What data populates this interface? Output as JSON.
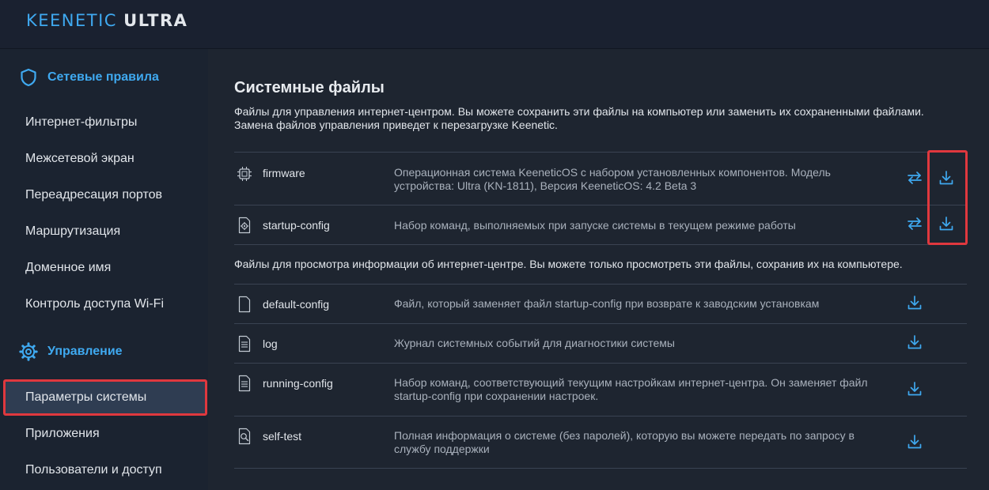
{
  "header": {
    "brand": "KEENETIC",
    "model": "ULTRA"
  },
  "sidebar": {
    "section1": {
      "title": "Сетевые правила",
      "icon": "shield-icon"
    },
    "section1_items": [
      {
        "label": "Интернет-фильтры"
      },
      {
        "label": "Межсетевой экран"
      },
      {
        "label": "Переадресация портов"
      },
      {
        "label": "Маршрутизация"
      },
      {
        "label": "Доменное имя"
      },
      {
        "label": "Контроль доступа Wi-Fi"
      }
    ],
    "section2": {
      "title": "Управление",
      "icon": "gear-icon"
    },
    "section2_items": [
      {
        "label": "Параметры системы"
      },
      {
        "label": "Приложения"
      },
      {
        "label": "Пользователи и доступ"
      }
    ]
  },
  "main": {
    "title": "Системные файлы",
    "description": "Файлы для управления интернет-центром. Вы можете сохранить эти файлы на компьютер или заменить их сохраненными файлами. Замена файлов управления приведет к перезагрузке Keenetic.",
    "managed_files": [
      {
        "name": "firmware",
        "description": "Операционная система KeeneticOS с набором установленных компонентов. Модель устройства: Ultra (KN-1811), Версия KeeneticOS: 4.2 Beta 3",
        "icon": "chip-icon"
      },
      {
        "name": "startup-config",
        "description": "Набор команд, выполняемых при запуске системы в текущем режиме работы",
        "icon": "settings-file-icon"
      }
    ],
    "view_description": "Файлы для просмотра информации об интернет-центре. Вы можете только просмотреть эти файлы, сохранив их на компьютере.",
    "view_files": [
      {
        "name": "default-config",
        "description": "Файл, который заменяет файл startup-config при возврате к заводским установкам",
        "icon": "blank-file-icon"
      },
      {
        "name": "log",
        "description": "Журнал системных событий для диагностики системы",
        "icon": "text-file-icon"
      },
      {
        "name": "running-config",
        "description": "Набор команд, соответствующий текущим настройкам интернет-центра. Он заменяет файл startup-config при сохранении настроек.",
        "icon": "text-file-icon"
      },
      {
        "name": "self-test",
        "description": "Полная информация о системе (без паролей), которую вы можете передать по запросу в службу поддержки",
        "icon": "search-file-icon"
      }
    ]
  },
  "colors": {
    "accent": "#3fa9f0",
    "highlight": "#e0383e",
    "background": "#1e2530",
    "sidebar": "#1b2330",
    "active_item": "#2f3d52"
  }
}
